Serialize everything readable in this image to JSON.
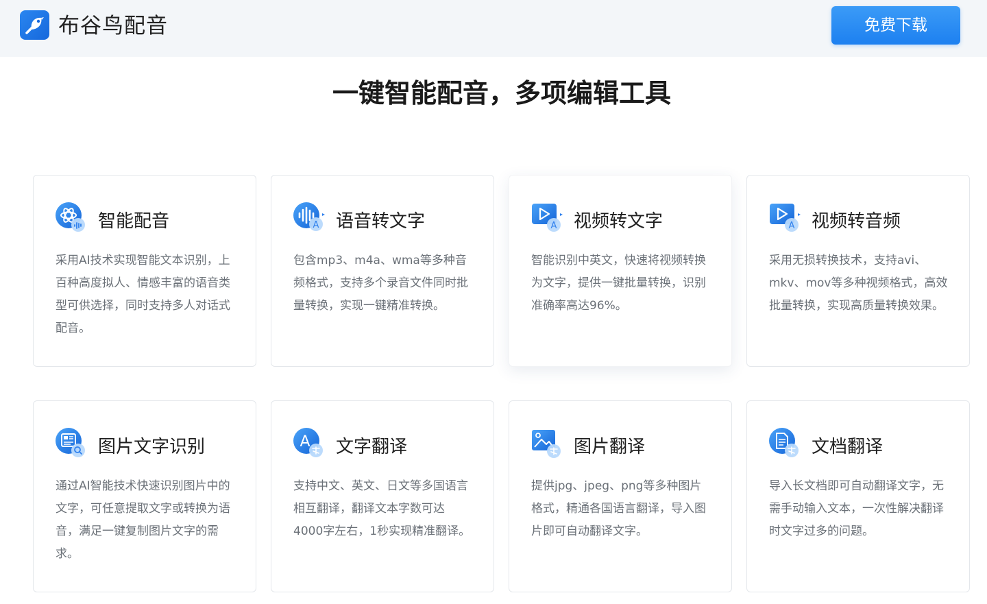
{
  "header": {
    "brand_name": "布谷鸟配音",
    "download_label": "免费下载"
  },
  "page_title": "一键智能配音，多项编辑工具",
  "features": [
    {
      "title": "智能配音",
      "icon": "atom-audio-icon",
      "desc": "采用AI技术实现智能文本识别，上百种高度拟人、情感丰富的语音类型可供选择，同时支持多人对话式配音。"
    },
    {
      "title": "语音转文字",
      "icon": "audio-wave-text-icon",
      "desc": "包含mp3、m4a、wma等多种音频格式，支持多个录音文件同时批量转换，实现一键精准转换。"
    },
    {
      "title": "视频转文字",
      "icon": "video-text-icon",
      "desc": "智能识别中英文，快速将视频转换为文字，提供一键批量转换，识别准确率高达96%。"
    },
    {
      "title": "视频转音频",
      "icon": "video-audio-icon",
      "desc": "采用无损转换技术，支持avi、mkv、mov等多种视频格式，高效批量转换，实现高质量转换效果。"
    },
    {
      "title": "图片文字识别",
      "icon": "image-ocr-icon",
      "desc": "通过AI智能技术快速识别图片中的文字，可任意提取文字或转换为语音，满足一键复制图片文字的需求。"
    },
    {
      "title": "文字翻译",
      "icon": "text-translate-icon",
      "desc": "支持中文、英文、日文等多国语言相互翻译，翻译文本字数可达4000字左右，1秒实现精准翻译。"
    },
    {
      "title": "图片翻译",
      "icon": "image-translate-icon",
      "desc": "提供jpg、jpeg、png等多种图片格式，精通各国语言翻译，导入图片即可自动翻译文字。"
    },
    {
      "title": "文档翻译",
      "icon": "document-translate-icon",
      "desc": "导入长文档即可自动翻译文字，无需手动输入文本，一次性解决翻译时文字过多的问题。"
    }
  ],
  "colors": {
    "accent": "#1d80f0",
    "icon_gradient_start": "#4aa3f8",
    "icon_gradient_end": "#1565d8",
    "badge": "#9cc9fb",
    "header_bg": "#f3f6f9"
  }
}
